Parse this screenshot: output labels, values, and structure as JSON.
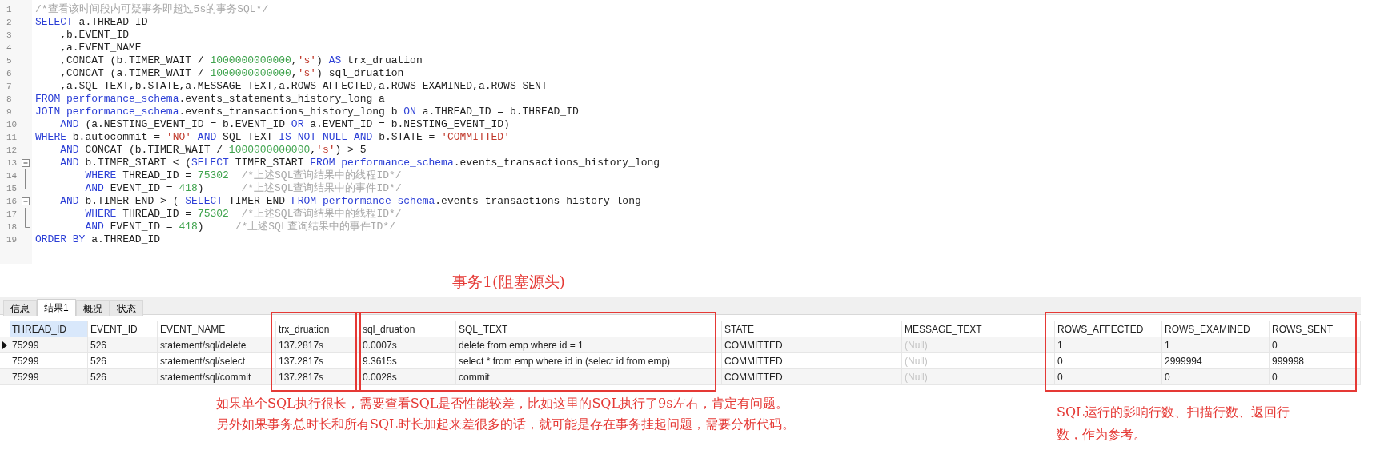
{
  "editor": {
    "lines": [
      {
        "number": "1",
        "tokens": [
          {
            "kind": "comment",
            "text": "/*查看该时间段内可疑事务即超过5s的事务SQL*/"
          }
        ]
      },
      {
        "number": "2",
        "tokens": [
          {
            "kind": "keyword",
            "text": "SELECT"
          },
          {
            "kind": "plain",
            "text": " a.THREAD_ID"
          }
        ]
      },
      {
        "number": "3",
        "tokens": [
          {
            "kind": "plain",
            "text": "    ,b.EVENT_ID"
          }
        ]
      },
      {
        "number": "4",
        "tokens": [
          {
            "kind": "plain",
            "text": "    ,a.EVENT_NAME"
          }
        ]
      },
      {
        "number": "5",
        "tokens": [
          {
            "kind": "plain",
            "text": "    ,CONCAT (b.TIMER_WAIT / "
          },
          {
            "kind": "number",
            "text": "1000000000000"
          },
          {
            "kind": "plain",
            "text": ","
          },
          {
            "kind": "string",
            "text": "'s'"
          },
          {
            "kind": "plain",
            "text": ") "
          },
          {
            "kind": "keyword",
            "text": "AS"
          },
          {
            "kind": "plain",
            "text": " trx_druation"
          }
        ]
      },
      {
        "number": "6",
        "tokens": [
          {
            "kind": "plain",
            "text": "    ,CONCAT (a.TIMER_WAIT / "
          },
          {
            "kind": "number",
            "text": "1000000000000"
          },
          {
            "kind": "plain",
            "text": ","
          },
          {
            "kind": "string",
            "text": "'s'"
          },
          {
            "kind": "plain",
            "text": ") sql_druation"
          }
        ]
      },
      {
        "number": "7",
        "tokens": [
          {
            "kind": "plain",
            "text": "    ,a.SQL_TEXT,b.STATE,a.MESSAGE_TEXT,a.ROWS_AFFECTED,a.ROWS_EXAMINED,a.ROWS_SENT"
          }
        ]
      },
      {
        "number": "8",
        "tokens": [
          {
            "kind": "keyword",
            "text": "FROM performance_schema"
          },
          {
            "kind": "plain",
            "text": ".events_statements_history_long a"
          }
        ]
      },
      {
        "number": "9",
        "tokens": [
          {
            "kind": "keyword",
            "text": "JOIN performance_schema"
          },
          {
            "kind": "plain",
            "text": ".events_transactions_history_long b "
          },
          {
            "kind": "keyword",
            "text": "ON"
          },
          {
            "kind": "plain",
            "text": " a.THREAD_ID = b.THREAD_ID"
          }
        ]
      },
      {
        "number": "10",
        "tokens": [
          {
            "kind": "keyword",
            "text": "    AND"
          },
          {
            "kind": "plain",
            "text": " (a.NESTING_EVENT_ID = b.EVENT_ID "
          },
          {
            "kind": "keyword",
            "text": "OR"
          },
          {
            "kind": "plain",
            "text": " a.EVENT_ID = b.NESTING_EVENT_ID)"
          }
        ]
      },
      {
        "number": "11",
        "tokens": [
          {
            "kind": "keyword",
            "text": "WHERE"
          },
          {
            "kind": "plain",
            "text": " b.autocommit = "
          },
          {
            "kind": "string",
            "text": "'NO'"
          },
          {
            "kind": "keyword",
            "text": " AND"
          },
          {
            "kind": "plain",
            "text": " SQL_TEXT "
          },
          {
            "kind": "keyword",
            "text": "IS NOT NULL AND"
          },
          {
            "kind": "plain",
            "text": " b.STATE = "
          },
          {
            "kind": "string",
            "text": "'COMMITTED'"
          }
        ]
      },
      {
        "number": "12",
        "tokens": [
          {
            "kind": "keyword",
            "text": "    AND"
          },
          {
            "kind": "plain",
            "text": " CONCAT (b.TIMER_WAIT / "
          },
          {
            "kind": "number",
            "text": "1000000000000"
          },
          {
            "kind": "plain",
            "text": ","
          },
          {
            "kind": "string",
            "text": "'s'"
          },
          {
            "kind": "plain",
            "text": ") > 5"
          }
        ]
      },
      {
        "number": "13",
        "expanded": true,
        "tokens": [
          {
            "kind": "keyword",
            "text": "    AND"
          },
          {
            "kind": "plain",
            "text": " b.TIMER_START < ("
          },
          {
            "kind": "keyword",
            "text": "SELECT"
          },
          {
            "kind": "plain",
            "text": " TIMER_START "
          },
          {
            "kind": "keyword",
            "text": "FROM performance_schema"
          },
          {
            "kind": "plain",
            "text": ".events_transactions_history_long"
          }
        ],
        "children": [
          {
            "number": "14",
            "tokens": [
              {
                "kind": "keyword",
                "text": "        WHERE"
              },
              {
                "kind": "plain",
                "text": " THREAD_ID = "
              },
              {
                "kind": "number",
                "text": "75302"
              },
              {
                "kind": "comment",
                "text": "  /*上述SQL查询结果中的线程ID*/"
              }
            ]
          },
          {
            "number": "15",
            "tokens": [
              {
                "kind": "keyword",
                "text": "        AND"
              },
              {
                "kind": "plain",
                "text": " EVENT_ID = "
              },
              {
                "kind": "number",
                "text": "418"
              },
              {
                "kind": "plain",
                "text": ")"
              },
              {
                "kind": "comment",
                "text": "      /*上述SQL查询结果中的事件ID*/"
              }
            ]
          }
        ]
      },
      {
        "number": "16",
        "expanded": true,
        "tokens": [
          {
            "kind": "keyword",
            "text": "    AND"
          },
          {
            "kind": "plain",
            "text": " b.TIMER_END > ( "
          },
          {
            "kind": "keyword",
            "text": "SELECT"
          },
          {
            "kind": "plain",
            "text": " TIMER_END "
          },
          {
            "kind": "keyword",
            "text": "FROM performance_schema"
          },
          {
            "kind": "plain",
            "text": ".events_transactions_history_long"
          }
        ],
        "children": [
          {
            "number": "17",
            "tokens": [
              {
                "kind": "keyword",
                "text": "        WHERE"
              },
              {
                "kind": "plain",
                "text": " THREAD_ID = "
              },
              {
                "kind": "number",
                "text": "75302"
              },
              {
                "kind": "comment",
                "text": "  /*上述SQL查询结果中的线程ID*/"
              }
            ]
          },
          {
            "number": "18",
            "tokens": [
              {
                "kind": "keyword",
                "text": "        AND"
              },
              {
                "kind": "plain",
                "text": " EVENT_ID = "
              },
              {
                "kind": "number",
                "text": "418"
              },
              {
                "kind": "plain",
                "text": ")"
              },
              {
                "kind": "comment",
                "text": "     /*上述SQL查询结果中的事件ID*/"
              }
            ]
          }
        ]
      },
      {
        "number": "19",
        "tokens": [
          {
            "kind": "keyword",
            "text": "ORDER BY"
          },
          {
            "kind": "plain",
            "text": " a.THREAD_ID"
          }
        ]
      }
    ]
  },
  "result_title": "事务1(阻塞源头)",
  "tabs": [
    {
      "label": "信息",
      "selected": false
    },
    {
      "label": "结果1",
      "selected": true
    },
    {
      "label": "概况",
      "selected": false
    },
    {
      "label": "状态",
      "selected": false
    }
  ],
  "table": {
    "columns": [
      {
        "label": "THREAD_ID",
        "selected": true
      },
      {
        "label": "EVENT_ID",
        "selected": false
      },
      {
        "label": "EVENT_NAME",
        "selected": false
      },
      {
        "label": "trx_druation",
        "selected": false
      },
      {
        "label": "sql_druation",
        "selected": false
      },
      {
        "label": "SQL_TEXT",
        "selected": false
      },
      {
        "label": "STATE",
        "selected": false
      },
      {
        "label": "MESSAGE_TEXT",
        "selected": false
      },
      {
        "label": "ROWS_AFFECTED",
        "selected": false
      },
      {
        "label": "ROWS_EXAMINED",
        "selected": false
      },
      {
        "label": "ROWS_SENT",
        "selected": false
      }
    ],
    "rows": [
      {
        "selected": true,
        "cells": [
          "75299",
          "526",
          "statement/sql/delete",
          "137.2817s",
          "0.0007s",
          "delete from emp where id = 1",
          "COMMITTED",
          {
            "text": "(Null)",
            "null": true
          },
          "1",
          "1",
          "0"
        ]
      },
      {
        "selected": false,
        "cells": [
          "75299",
          "526",
          "statement/sql/select",
          "137.2817s",
          "9.3615s",
          "select * from emp where id in (select id from emp)",
          "COMMITTED",
          {
            "text": "(Null)",
            "null": true
          },
          "0",
          "2999994",
          "999998"
        ]
      },
      {
        "selected": false,
        "cells": [
          "75299",
          "526",
          "statement/sql/commit",
          "137.2817s",
          "0.0028s",
          "commit",
          "COMMITTED",
          {
            "text": "(Null)",
            "null": true
          },
          "0",
          "0",
          "0"
        ]
      }
    ]
  },
  "notes": [
    "如果单个SQL执行很长，需要查看SQL是否性能较差，比如这里的SQL执行了9s左右，肯定有问题。",
    "另外如果事务总时长和所有SQL时长加起来差很多的话，就可能是存在事务挂起问题，需要分析代码。"
  ],
  "side_note": "SQL运行的影响行数、扫描行数、返回行数，作为参考。"
}
